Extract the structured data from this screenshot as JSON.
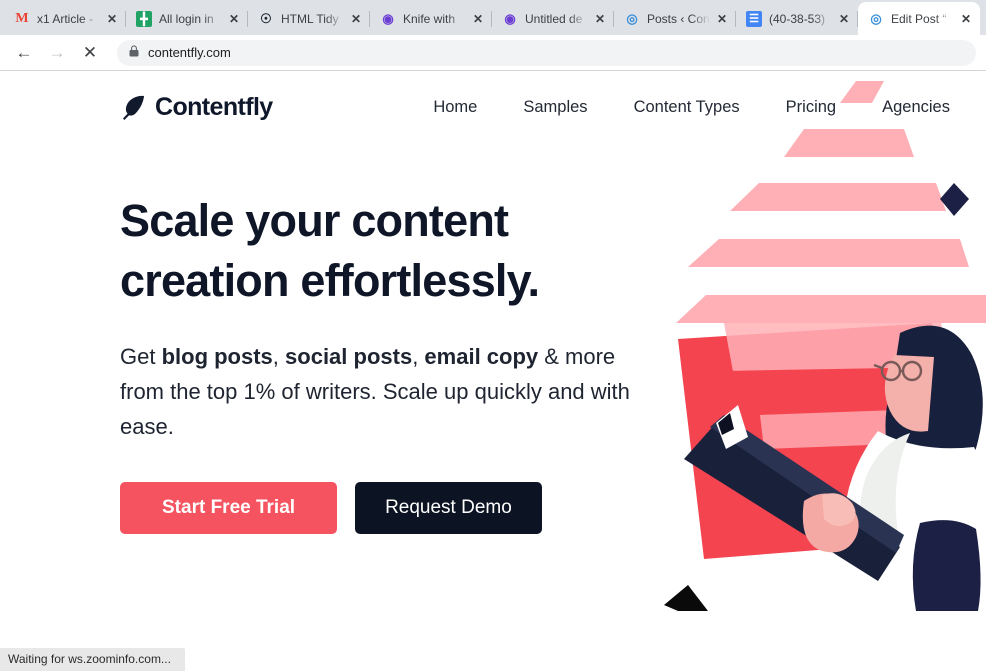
{
  "browser": {
    "tabs": [
      {
        "title": "x1 Article -",
        "favicon": "gmail-icon",
        "active": false
      },
      {
        "title": "All login in",
        "favicon": "sheets-icon",
        "active": false
      },
      {
        "title": "HTML Tidy",
        "favicon": "html-tidy-icon",
        "active": false
      },
      {
        "title": "Knife with",
        "favicon": "c-circle-icon",
        "active": false
      },
      {
        "title": "Untitled de",
        "favicon": "c-circle-icon",
        "active": false
      },
      {
        "title": "Posts ‹ Con",
        "favicon": "r-circle-icon",
        "active": false
      },
      {
        "title": "(40-38-53)",
        "favicon": "docs-icon",
        "active": false
      },
      {
        "title": "Edit Post “",
        "favicon": "r-circle-icon",
        "active": true
      }
    ],
    "toolbar": {
      "back_label": "←",
      "forward_label": "→",
      "stop_label": "✕",
      "lock_label": "🔒",
      "url": "contentfly.com"
    },
    "status_text": "Waiting for ws.zoominfo.com...",
    "close_label": "✕"
  },
  "site": {
    "brand": "Contentfly",
    "nav": [
      {
        "label": "Home"
      },
      {
        "label": "Samples"
      },
      {
        "label": "Content Types"
      },
      {
        "label": "Pricing"
      },
      {
        "label": "Agencies"
      }
    ],
    "hero": {
      "headline": "Scale your content creation effortlessly.",
      "sub_lead": "Get ",
      "sub_bold1": "blog posts",
      "sub_c1": ", ",
      "sub_bold2": "social posts",
      "sub_c2": ", ",
      "sub_bold3": "email copy",
      "sub_tail": " & more from the top 1% of writers. Scale up quickly and with ease.",
      "primary_cta": "Start Free Trial",
      "secondary_cta": "Request Demo"
    },
    "colors": {
      "accent_coral": "#f4535f",
      "dark_navy": "#0c1322",
      "stripe_pink": "#ffb0b6",
      "paper_red": "#f4444f",
      "skin": "#f4a9a4"
    }
  }
}
